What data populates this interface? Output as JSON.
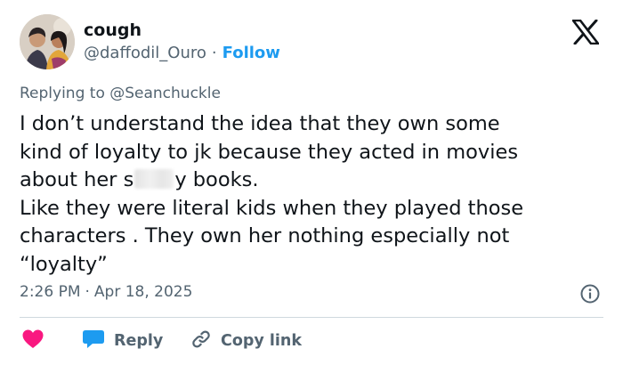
{
  "author": {
    "display_name": "cough",
    "handle": "@daffodil_Ouro",
    "separator": "·",
    "follow_label": "Follow",
    "avatar": "illustrated-couple-avatar"
  },
  "platform": {
    "logo": "x-logo-icon"
  },
  "reply_context": {
    "text": "Replying to @Seanchuckle"
  },
  "tweet": {
    "lines": {
      "l1": "I don’t understand the idea that they own some",
      "l2": "kind of loyalty to jk because they acted in movies",
      "l3_before": "about her s",
      "l3_after": "y books.",
      "l4": "Like they were literal kids when they played those",
      "l5": "characters .  They own her nothing especially not",
      "l6": "“loyalty”"
    }
  },
  "meta": {
    "time": "2:26 PM",
    "separator": "·",
    "date": "Apr 18, 2025",
    "info_icon": "info-circle-icon"
  },
  "actions": {
    "like_icon": "heart-icon",
    "reply_label": "Reply",
    "reply_icon": "speech-bubble-icon",
    "copy_label": "Copy link",
    "copy_icon": "link-icon"
  },
  "colors": {
    "accent": "#1d9bf0",
    "like": "#f91880",
    "secondary_text": "#536471",
    "primary_text": "#0f1419",
    "divider": "#cfd9de"
  }
}
